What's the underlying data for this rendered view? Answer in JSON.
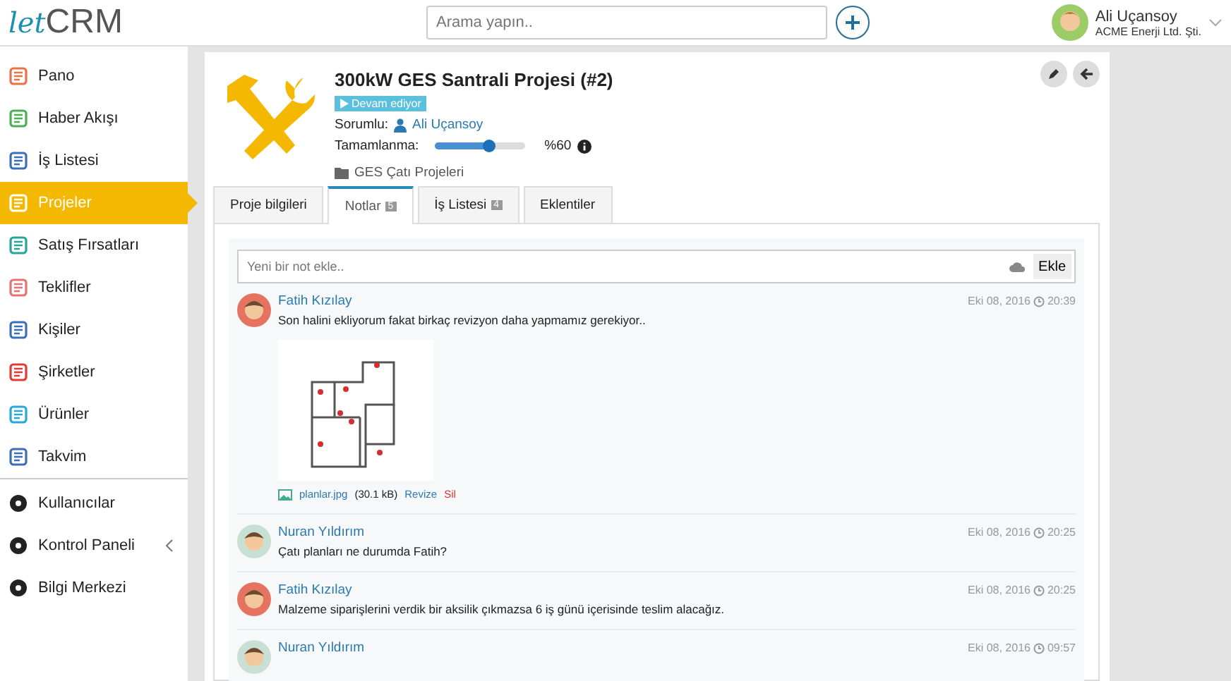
{
  "logo": {
    "prefix": "let",
    "suffix": "CRM"
  },
  "search": {
    "placeholder": "Arama yapın.."
  },
  "user": {
    "name": "Ali Uçansoy",
    "company": "ACME Enerji Ltd. Şti."
  },
  "sidebar": {
    "items": [
      {
        "label": "Pano",
        "selected": false
      },
      {
        "label": "Haber Akışı",
        "selected": false
      },
      {
        "label": "İş Listesi",
        "selected": false
      },
      {
        "label": "Projeler",
        "selected": true
      },
      {
        "label": "Satış Fırsatları",
        "selected": false
      },
      {
        "label": "Teklifler",
        "selected": false
      },
      {
        "label": "Kişiler",
        "selected": false
      },
      {
        "label": "Şirketler",
        "selected": false
      },
      {
        "label": "Ürünler",
        "selected": false
      },
      {
        "label": "Takvim",
        "selected": false
      }
    ],
    "admin_items": [
      {
        "label": "Kullanıcılar",
        "expandable": false
      },
      {
        "label": "Kontrol Paneli",
        "expandable": true
      },
      {
        "label": "Bilgi Merkezi",
        "expandable": false
      }
    ]
  },
  "project": {
    "title": "300kW GES Santrali Projesi (#2)",
    "status": "Devam ediyor",
    "owner_label": "Sorumlu:",
    "owner": "Ali Uçansoy",
    "progress_label": "Tamamlanma:",
    "level": 0.6,
    "progress_text": "%60",
    "category": "GES Çatı Projeleri"
  },
  "tabs": [
    {
      "label": "Proje bilgileri",
      "selected": false
    },
    {
      "label": "Notlar",
      "badge": "5",
      "selected": true
    },
    {
      "label": "İş Listesi",
      "badge": "4",
      "selected": false
    },
    {
      "label": "Eklentiler",
      "selected": false
    }
  ],
  "note_input": {
    "placeholder": "Yeni bir not ekle..",
    "button": "Ekle"
  },
  "notes": [
    {
      "author": "Fatih Kızılay",
      "color": "#e57360",
      "text": "Son halini ekliyorum fakat birkaç revizyon daha yapmamız gerekiyor..",
      "date": "Eki 08, 2016",
      "time": "20:39",
      "attachment": {
        "file": "planlar.jpg",
        "size": "(30.1 kB)",
        "revise": "Revize",
        "delete": "Sil"
      }
    },
    {
      "author": "Nuran Yıldırım",
      "color": "#c8e0d4",
      "text": "Çatı planları ne durumda Fatih?",
      "date": "Eki 08, 2016",
      "time": "20:25"
    },
    {
      "author": "Fatih Kızılay",
      "color": "#e57360",
      "text": "Malzeme siparişlerini verdik bir aksilik çıkmazsa 6 iş günü içerisinde teslim alacağız.",
      "date": "Eki 08, 2016",
      "time": "20:25"
    },
    {
      "author": "Nuran Yıldırım",
      "color": "#c8e0d4",
      "date": "Eki 08, 2016",
      "time": "09:57"
    }
  ]
}
